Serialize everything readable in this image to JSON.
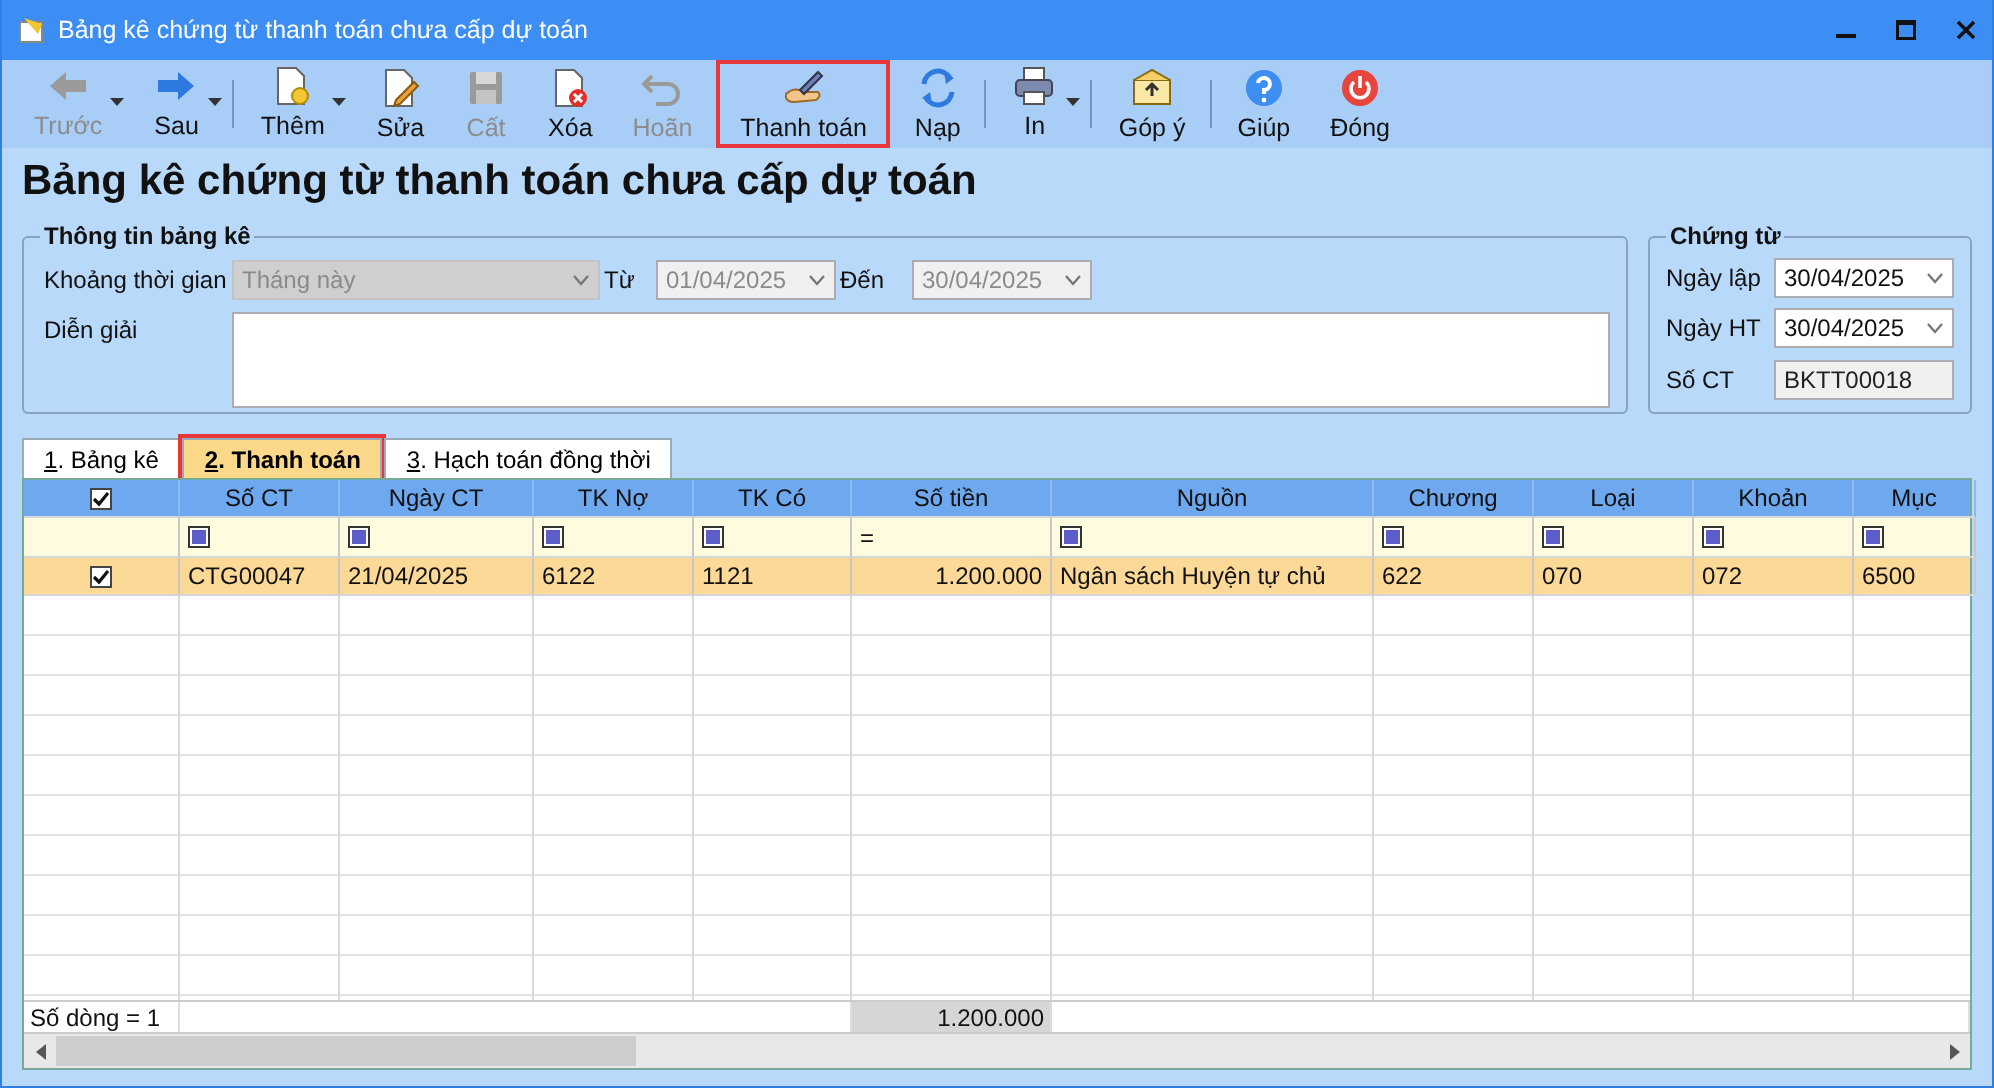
{
  "window": {
    "title": "Bảng kê chứng từ thanh toán chưa cấp dự toán"
  },
  "toolbar": [
    {
      "kind": "back",
      "label": "Trước",
      "disabled": true,
      "dropdown": true,
      "highlighted": false,
      "separator_after": false
    },
    {
      "kind": "forward",
      "label": "Sau",
      "disabled": false,
      "dropdown": true,
      "highlighted": false,
      "separator_after": true
    },
    {
      "kind": "add",
      "label": "Thêm",
      "disabled": false,
      "dropdown": true,
      "highlighted": false,
      "separator_after": false
    },
    {
      "kind": "edit",
      "label": "Sửa",
      "disabled": false,
      "dropdown": false,
      "highlighted": false,
      "separator_after": false
    },
    {
      "kind": "save",
      "label": "Cất",
      "disabled": true,
      "dropdown": false,
      "highlighted": false,
      "separator_after": false
    },
    {
      "kind": "delete",
      "label": "Xóa",
      "disabled": false,
      "dropdown": false,
      "highlighted": false,
      "separator_after": false
    },
    {
      "kind": "undo",
      "label": "Hoãn",
      "disabled": true,
      "dropdown": false,
      "highlighted": false,
      "separator_after": false
    },
    {
      "kind": "pay",
      "label": "Thanh toán",
      "disabled": false,
      "dropdown": false,
      "highlighted": true,
      "separator_after": false
    },
    {
      "kind": "reload",
      "label": "Nạp",
      "disabled": false,
      "dropdown": false,
      "highlighted": false,
      "separator_after": true
    },
    {
      "kind": "print",
      "label": "In",
      "disabled": false,
      "dropdown": true,
      "highlighted": false,
      "separator_after": true
    },
    {
      "kind": "feedback",
      "label": "Góp ý",
      "disabled": false,
      "dropdown": false,
      "highlighted": false,
      "separator_after": true
    },
    {
      "kind": "help",
      "label": "Giúp",
      "disabled": false,
      "dropdown": false,
      "highlighted": false,
      "separator_after": false
    },
    {
      "kind": "close",
      "label": "Đóng",
      "disabled": false,
      "dropdown": false,
      "highlighted": false,
      "separator_after": false
    }
  ],
  "heading": "Bảng kê chứng từ thanh toán chưa cấp dự toán",
  "info_group": {
    "title": "Thông tin bảng kê",
    "period": {
      "label": "Khoảng thời gian",
      "value": "Tháng này",
      "disabled": true
    },
    "from": {
      "label": "Từ",
      "value": "01/04/2025",
      "disabled": true
    },
    "to": {
      "label": "Đến",
      "value": "30/04/2025",
      "disabled": true
    },
    "description": {
      "label": "Diễn giải"
    }
  },
  "voucher_group": {
    "title": "Chứng từ",
    "fields": [
      {
        "kind": "date",
        "label": "Ngày lập",
        "value": "30/04/2025"
      },
      {
        "kind": "date",
        "label": "Ngày HT",
        "value": "30/04/2025"
      },
      {
        "kind": "readonly",
        "label": "Số CT",
        "value": "BKTT00018"
      }
    ]
  },
  "tabs": [
    {
      "hotkey": "1",
      "label": ". Bảng kê",
      "selected": false,
      "highlighted": false
    },
    {
      "hotkey": "2",
      "label": ". Thanh toán",
      "selected": true,
      "highlighted": true
    },
    {
      "hotkey": "3",
      "label": ". Hạch toán đồng thời",
      "selected": false,
      "highlighted": false
    }
  ],
  "table": {
    "header_checked": true,
    "columns": [
      {
        "kind": "text",
        "label": "Số CT",
        "filter": {
          "kind": "box"
        }
      },
      {
        "kind": "text",
        "label": "Ngày CT",
        "filter": {
          "kind": "box"
        }
      },
      {
        "kind": "text",
        "label": "TK Nợ",
        "filter": {
          "kind": "box"
        }
      },
      {
        "kind": "text",
        "label": "TK Có",
        "filter": {
          "kind": "box"
        }
      },
      {
        "kind": "money",
        "label": "Số tiền",
        "filter": {
          "kind": "operator",
          "text": "="
        }
      },
      {
        "kind": "text",
        "label": "Nguồn",
        "filter": {
          "kind": "box"
        }
      },
      {
        "kind": "text",
        "label": "Chương",
        "filter": {
          "kind": "box"
        }
      },
      {
        "kind": "text",
        "label": "Loại",
        "filter": {
          "kind": "box"
        }
      },
      {
        "kind": "text",
        "label": "Khoản",
        "filter": {
          "kind": "box"
        }
      },
      {
        "kind": "text",
        "label": "Mục",
        "filter": {
          "kind": "box"
        }
      }
    ],
    "rows": [
      {
        "checked": true,
        "selected": true,
        "cells": [
          "CTG00047",
          "21/04/2025",
          "6122",
          "1121",
          "1.200.000",
          "Ngân sách Huyện tự chủ",
          "622",
          "070",
          "072",
          "6500"
        ]
      }
    ],
    "footer": {
      "label": "Số dòng = 1",
      "total": "1.200.000"
    }
  }
}
